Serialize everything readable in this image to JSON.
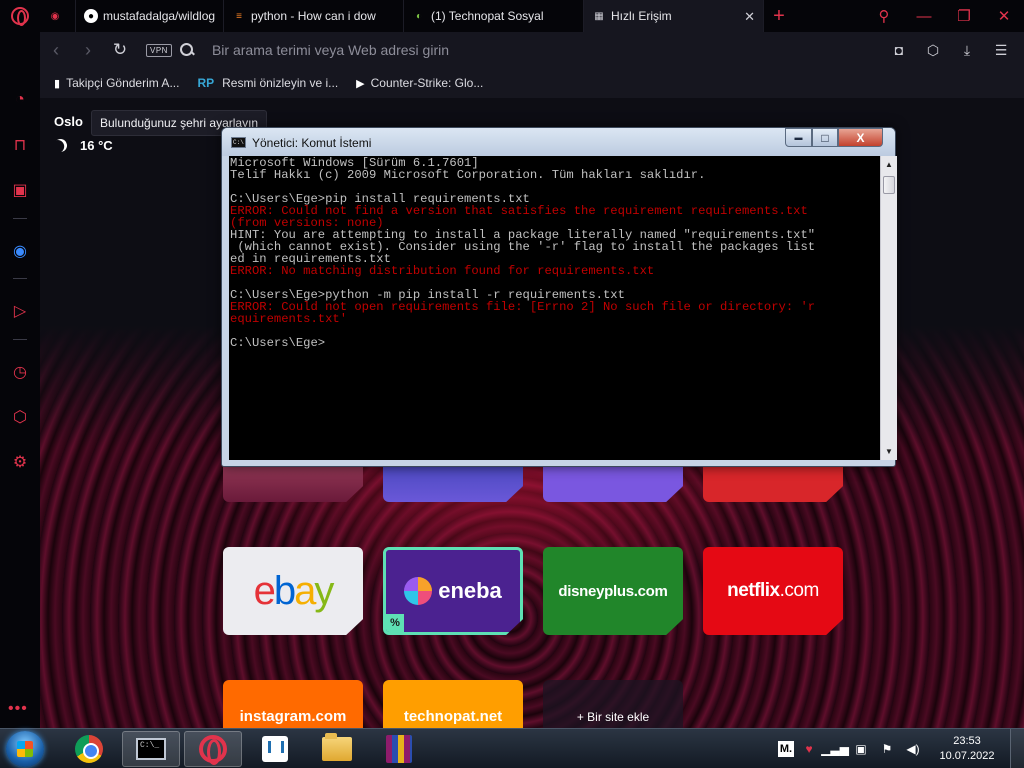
{
  "browser": {
    "tabs": [
      {
        "label": "",
        "icon": "gamepad-icon"
      },
      {
        "label": "mustafadalga/wildlogge",
        "icon": "github-icon"
      },
      {
        "label": "python - How can i dow",
        "icon": "stackoverflow-icon"
      },
      {
        "label": "(1) Technopat Sosyal",
        "icon": "technopat-icon"
      },
      {
        "label": "Hızlı Erişim",
        "icon": "speed-dial-icon",
        "active": true
      }
    ],
    "address_placeholder": "Bir arama terimi veya Web adresi girin",
    "vpn_label": "VPN",
    "bookmarks": [
      {
        "label": "Takipçi Gönderim A...",
        "icon": "page-icon"
      },
      {
        "label": "Resmi önizleyin ve i...",
        "icon": "rp-icon",
        "prefix": "RP"
      },
      {
        "label": "Counter-Strike: Glo...",
        "icon": "play-icon"
      }
    ]
  },
  "speed_dial": {
    "city": "Oslo",
    "temperature": "16 °C",
    "tooltip": "Bulunduğunuz şehri ayarlayın",
    "tiles": [
      {
        "name": "ebay",
        "label": "ebay"
      },
      {
        "name": "eneba",
        "label": "eneba",
        "badge": "%"
      },
      {
        "name": "disneyplus",
        "label": "disneyplus.com"
      },
      {
        "name": "netflix",
        "label_main": "netflix",
        "label_suffix": ".com"
      },
      {
        "name": "instagram",
        "label": "instagram.com"
      },
      {
        "name": "technopat",
        "label": "technopat.net"
      },
      {
        "name": "add",
        "label": "+ Bir site ekle"
      }
    ]
  },
  "cmd_window": {
    "title": "Yönetici: Komut İstemi",
    "lines": [
      {
        "text": "Microsoft Windows [Sürüm 6.1.7601]",
        "error": false
      },
      {
        "text": "Telif Hakkı (c) 2009 Microsoft Corporation. Tüm hakları saklıdır.",
        "error": false
      },
      {
        "text": "",
        "error": false
      },
      {
        "text": "C:\\Users\\Ege>pip install requirements.txt",
        "error": false
      },
      {
        "text": "ERROR: Could not find a version that satisfies the requirement requirements.txt",
        "error": true
      },
      {
        "text": "(from versions: none)",
        "error": true
      },
      {
        "text": "HINT: You are attempting to install a package literally named \"requirements.txt\"",
        "error": false
      },
      {
        "text": " (which cannot exist). Consider using the '-r' flag to install the packages list",
        "error": false
      },
      {
        "text": "ed in requirements.txt",
        "error": false
      },
      {
        "text": "ERROR: No matching distribution found for requirements.txt",
        "error": true
      },
      {
        "text": "",
        "error": false
      },
      {
        "text": "C:\\Users\\Ege>python -m pip install -r requirements.txt",
        "error": false
      },
      {
        "text": "ERROR: Could not open requirements file: [Errno 2] No such file or directory: 'r",
        "error": true
      },
      {
        "text": "equirements.txt'",
        "error": true
      },
      {
        "text": "",
        "error": false
      },
      {
        "text": "C:\\Users\\Ege>",
        "error": false
      }
    ],
    "min_label": "▬",
    "max_label": "□",
    "close_label": "X"
  },
  "taskbar": {
    "tray_m": "M.",
    "time": "23:53",
    "date": "10.07.2022"
  },
  "colors": {
    "opera_red": "#e1334c",
    "cmd_text": "#c0c0c0",
    "cmd_error": "#c00000"
  }
}
